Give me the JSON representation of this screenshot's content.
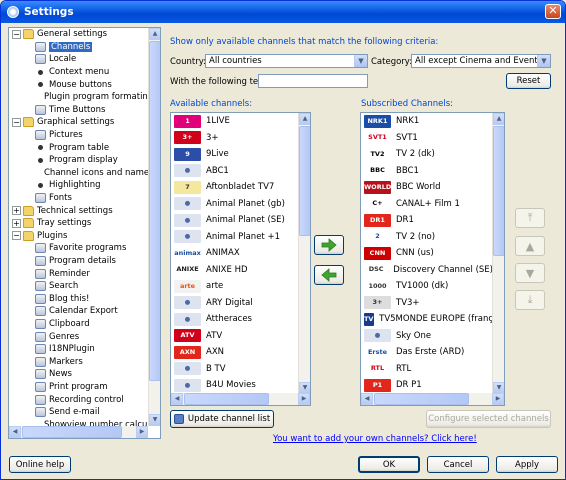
{
  "window": {
    "title": "Settings"
  },
  "tree": {
    "items": [
      {
        "label": "General settings",
        "level": 0,
        "kind": "folder",
        "expanded": true
      },
      {
        "label": "Channels",
        "level": 1,
        "kind": "icon",
        "selected": true
      },
      {
        "label": "Locale",
        "level": 1,
        "kind": "icon"
      },
      {
        "label": "Context menu",
        "level": 1,
        "kind": "bullet"
      },
      {
        "label": "Mouse buttons",
        "level": 1,
        "kind": "bullet"
      },
      {
        "label": "Plugin program formating",
        "level": 1,
        "kind": "bullet"
      },
      {
        "label": "Time Buttons",
        "level": 1,
        "kind": "icon"
      },
      {
        "label": "Graphical settings",
        "level": 0,
        "kind": "folder",
        "expanded": true
      },
      {
        "label": "Pictures",
        "level": 1,
        "kind": "icon"
      },
      {
        "label": "Program table",
        "level": 1,
        "kind": "bullet"
      },
      {
        "label": "Program display",
        "level": 1,
        "kind": "bullet"
      },
      {
        "label": "Channel icons and names",
        "level": 1,
        "kind": "bullet"
      },
      {
        "label": "Highlighting",
        "level": 1,
        "kind": "bullet"
      },
      {
        "label": "Fonts",
        "level": 1,
        "kind": "icon"
      },
      {
        "label": "Technical settings",
        "level": 0,
        "kind": "folder",
        "expanded": false
      },
      {
        "label": "Tray settings",
        "level": 0,
        "kind": "folder",
        "expanded": false
      },
      {
        "label": "Plugins",
        "level": 0,
        "kind": "folder",
        "expanded": true
      },
      {
        "label": "Favorite programs",
        "level": 1,
        "kind": "icon"
      },
      {
        "label": "Program details",
        "level": 1,
        "kind": "icon"
      },
      {
        "label": "Reminder",
        "level": 1,
        "kind": "icon"
      },
      {
        "label": "Search",
        "level": 1,
        "kind": "icon"
      },
      {
        "label": "Blog this!",
        "level": 1,
        "kind": "icon"
      },
      {
        "label": "Calendar Export",
        "level": 1,
        "kind": "icon"
      },
      {
        "label": "Clipboard",
        "level": 1,
        "kind": "icon"
      },
      {
        "label": "Genres",
        "level": 1,
        "kind": "icon"
      },
      {
        "label": "I18NPlugin",
        "level": 1,
        "kind": "icon"
      },
      {
        "label": "Markers",
        "level": 1,
        "kind": "icon"
      },
      {
        "label": "News",
        "level": 1,
        "kind": "icon"
      },
      {
        "label": "Print program",
        "level": 1,
        "kind": "icon"
      },
      {
        "label": "Recording control",
        "level": 1,
        "kind": "icon"
      },
      {
        "label": "Send e-mail",
        "level": 1,
        "kind": "icon"
      },
      {
        "label": "Showview number calculat",
        "level": 1,
        "kind": "bullet"
      }
    ]
  },
  "filter": {
    "heading": "Show only available channels that match the following criteria:",
    "country_label": "Country:",
    "country_value": "All countries",
    "category_label": "Category:",
    "category_value": "All except Cinema and Events",
    "text_label": "With the following text:",
    "text_value": "",
    "reset_label": "Reset"
  },
  "available": {
    "heading": "Available channels:",
    "channels": [
      {
        "name": "1LIVE",
        "logo": "1",
        "bg": "#E2007A",
        "fg": "#FFFFFF"
      },
      {
        "name": "3+",
        "logo": "3+",
        "bg": "#D0021B",
        "fg": "#FFFFFF"
      },
      {
        "name": "9Live",
        "logo": "9",
        "bg": "#2B4FA8",
        "fg": "#FFFFFF"
      },
      {
        "name": "ABC1",
        "logo": "●",
        "bg": "#DDE4F0",
        "fg": "#4A6BA8"
      },
      {
        "name": "Aftonbladet TV7",
        "logo": "7",
        "bg": "#F5E79E",
        "fg": "#333333"
      },
      {
        "name": "Animal Planet (gb)",
        "logo": "●",
        "bg": "#DDE4F0",
        "fg": "#4A6BA8"
      },
      {
        "name": "Animal Planet (SE)",
        "logo": "●",
        "bg": "#DDE4F0",
        "fg": "#4A6BA8"
      },
      {
        "name": "Animal Planet +1",
        "logo": "●",
        "bg": "#DDE4F0",
        "fg": "#4A6BA8"
      },
      {
        "name": "ANIMAX",
        "logo": "animax",
        "bg": "#FFFFFF",
        "fg": "#1A4EA3"
      },
      {
        "name": "ANIXE HD",
        "logo": "ANIXE",
        "bg": "#FFFFFF",
        "fg": "#222222"
      },
      {
        "name": "arte",
        "logo": "arte",
        "bg": "#F2F2F2",
        "fg": "#E2571C"
      },
      {
        "name": "ARY Digital",
        "logo": "●",
        "bg": "#DDE4F0",
        "fg": "#4A6BA8"
      },
      {
        "name": "Attheraces",
        "logo": "●",
        "bg": "#DDE4F0",
        "fg": "#4A6BA8"
      },
      {
        "name": "ATV",
        "logo": "ATV",
        "bg": "#D0021B",
        "fg": "#FFFFFF"
      },
      {
        "name": "AXN",
        "logo": "AXN",
        "bg": "#E1261C",
        "fg": "#FFFFFF"
      },
      {
        "name": "B TV",
        "logo": "●",
        "bg": "#DDE4F0",
        "fg": "#4A6BA8"
      },
      {
        "name": "B4U Movies",
        "logo": "●",
        "bg": "#DDE4F0",
        "fg": "#4A6BA8"
      }
    ]
  },
  "subscribed": {
    "heading": "Subscribed Channels:",
    "channels": [
      {
        "name": "NRK1",
        "logo": "NRK1",
        "bg": "#1A4DA8",
        "fg": "#FFFFFF"
      },
      {
        "name": "SVT1",
        "logo": "SVT1",
        "bg": "#FFFFFF",
        "fg": "#D0021B"
      },
      {
        "name": "TV 2 (dk)",
        "logo": "TV2",
        "bg": "#FFFFFF",
        "fg": "#000000"
      },
      {
        "name": "BBC1",
        "logo": "BBC",
        "bg": "#FFFFFF",
        "fg": "#000000"
      },
      {
        "name": "BBC World",
        "logo": "WORLD",
        "bg": "#B5121B",
        "fg": "#FFFFFF"
      },
      {
        "name": "CANAL+ Film 1",
        "logo": "C+",
        "bg": "#FFFFFF",
        "fg": "#000000"
      },
      {
        "name": "DR1",
        "logo": "DR1",
        "bg": "#E1261C",
        "fg": "#FFFFFF"
      },
      {
        "name": "TV 2 (no)",
        "logo": "2",
        "bg": "#FFFFFF",
        "fg": "#1A4DA8"
      },
      {
        "name": "CNN (us)",
        "logo": "CNN",
        "bg": "#CC0000",
        "fg": "#FFFFFF"
      },
      {
        "name": "Discovery Channel (SE)",
        "logo": "DSC",
        "bg": "#FFFFFF",
        "fg": "#333333"
      },
      {
        "name": "TV1000 (dk)",
        "logo": "1000",
        "bg": "#FFFFFF",
        "fg": "#333333"
      },
      {
        "name": "TV3+",
        "logo": "3+",
        "bg": "#DDDDDD",
        "fg": "#333333"
      },
      {
        "name": "TV5MONDE EUROPE (franç",
        "logo": "TV5",
        "bg": "#1A3A8C",
        "fg": "#FFFFFF"
      },
      {
        "name": "Sky One",
        "logo": "●",
        "bg": "#DDE4F0",
        "fg": "#4A6BA8"
      },
      {
        "name": "Das Erste (ARD)",
        "logo": "Erste",
        "bg": "#FFFFFF",
        "fg": "#1A4DA8"
      },
      {
        "name": "RTL",
        "logo": "RTL",
        "bg": "#FFFFFF",
        "fg": "#D0021B"
      },
      {
        "name": "DR P1",
        "logo": "P1",
        "bg": "#E1261C",
        "fg": "#FFFFFF"
      }
    ]
  },
  "buttons": {
    "update_channel_list": "Update channel list",
    "configure_selected": "Configure selected channels",
    "add_own_channels_link": "You want to add your own channels? Click here!",
    "online_help": "Online help",
    "ok": "OK",
    "cancel": "Cancel",
    "apply": "Apply"
  },
  "icons": {
    "add": "arrow-right-icon",
    "remove": "arrow-left-icon",
    "move_top": "move-top-icon",
    "move_up": "move-up-icon",
    "move_down": "move-down-icon",
    "move_bottom": "move-bottom-icon"
  }
}
